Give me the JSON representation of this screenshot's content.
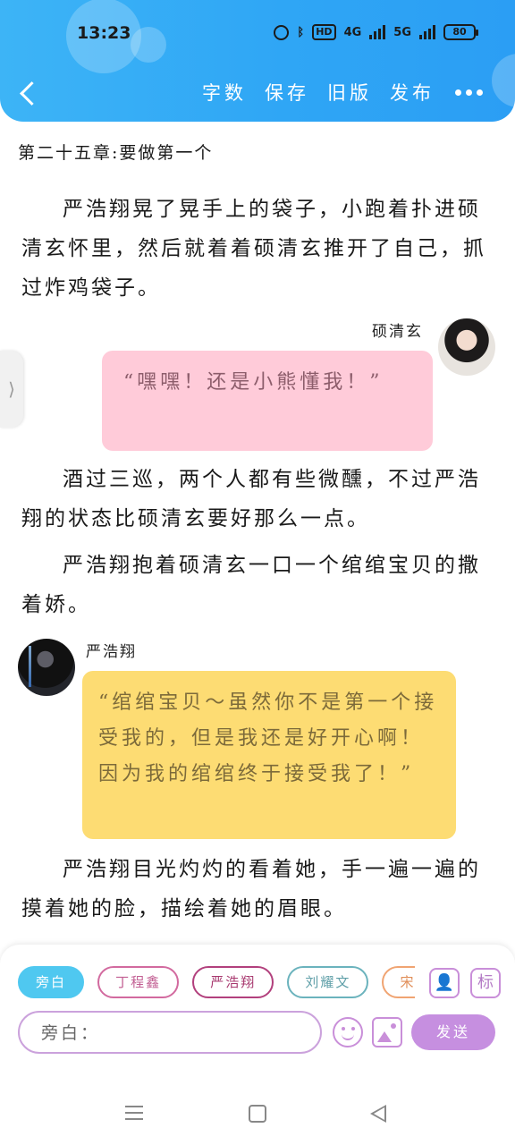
{
  "status_bar": {
    "time": "13:23",
    "hd_label": "HD",
    "net_4g": "4G",
    "net_5g": "5G",
    "battery": "80"
  },
  "header": {
    "actions": [
      "字数",
      "保存",
      "旧版",
      "发布"
    ],
    "accent_color": "#2fa6f5"
  },
  "chapter_title": "第二十五章:要做第一个",
  "paragraphs": [
    "严浩翔晃了晃手上的袋子，小跑着扑进硕清玄怀里，然后就着着硕清玄推开了自己，抓过炸鸡袋子。",
    "酒过三巡，两个人都有些微醺，不过严浩翔的状态比硕清玄要好那么一点。",
    "严浩翔抱着硕清玄一口一个绾绾宝贝的撒着娇。",
    "严浩翔目光灼灼的看着她，手一遍一遍的摸着她的脸，描绘着她的眉眼。"
  ],
  "dialogues": [
    {
      "speaker": "硕清玄",
      "text": "“嘿嘿！还是小熊懂我！”",
      "color": "#ffcbd9"
    },
    {
      "speaker": "严浩翔",
      "text": "“绾绾宝贝～虽然你不是第一个接受我的，但是我还是好开心啊！因为我的绾绾终于接受我了！”",
      "color": "#fddc73"
    }
  ],
  "side_tab": {
    "glyph": "⟩"
  },
  "input_panel": {
    "characters": [
      "旁白",
      "丁程鑫",
      "严浩翔",
      "刘耀文",
      "宋亚"
    ],
    "active_character": "旁白",
    "profile_icon": "person-card-icon",
    "tag_button": "标",
    "input_value": "旁白：",
    "send_label": "发送"
  },
  "nav_bar": {
    "icons": [
      "menu-icon",
      "home-icon",
      "back-icon"
    ]
  }
}
